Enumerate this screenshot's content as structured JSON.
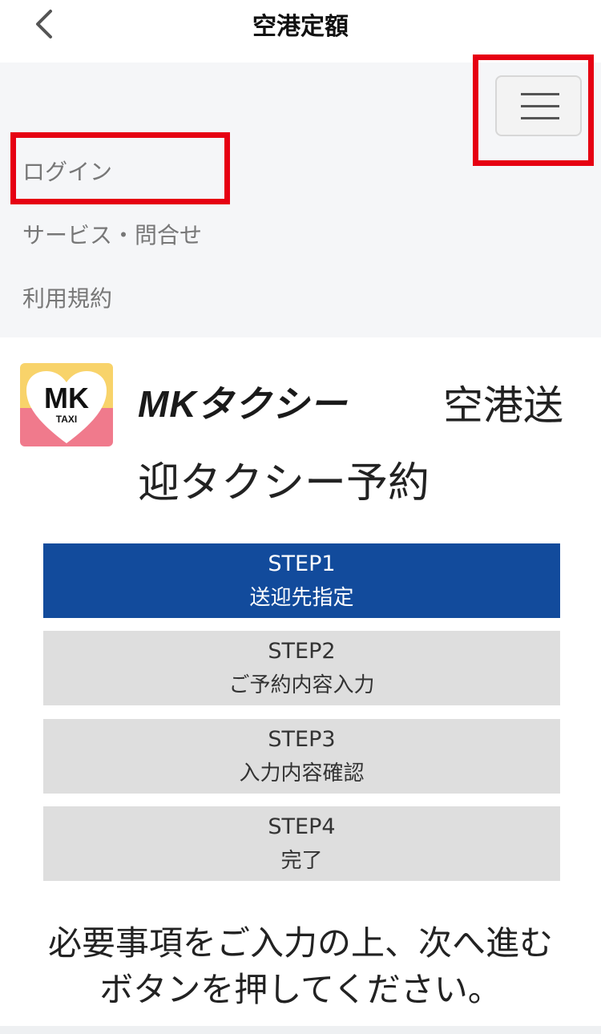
{
  "header": {
    "title": "空港定額",
    "back_icon": "chevron-left-icon"
  },
  "nav": {
    "menu_icon": "hamburger-menu-icon",
    "items": [
      {
        "label": "ログイン"
      },
      {
        "label": "サービス・問合せ"
      },
      {
        "label": "利用規約"
      }
    ]
  },
  "brand": {
    "logo_text": "MK",
    "logo_sub": "TAXI",
    "name": "MKタクシー",
    "service_title_line1": "空港送",
    "service_title_line2": "迎タクシー予約"
  },
  "steps": [
    {
      "step": "STEP1",
      "name": "送迎先指定",
      "active": true
    },
    {
      "step": "STEP2",
      "name": "ご予約内容入力",
      "active": false
    },
    {
      "step": "STEP3",
      "name": "入力内容確認",
      "active": false
    },
    {
      "step": "STEP4",
      "name": "完了",
      "active": false
    }
  ],
  "instruction": {
    "line1": "必要事項をご入力の上、次へ進む",
    "line2": "ボタンを押してください。"
  },
  "colors": {
    "active_step": "#124b9c",
    "inactive_step": "#dedede",
    "highlight": "#e60012",
    "logo_pink": "#f07a8c",
    "logo_yellow": "#f8d36a"
  }
}
